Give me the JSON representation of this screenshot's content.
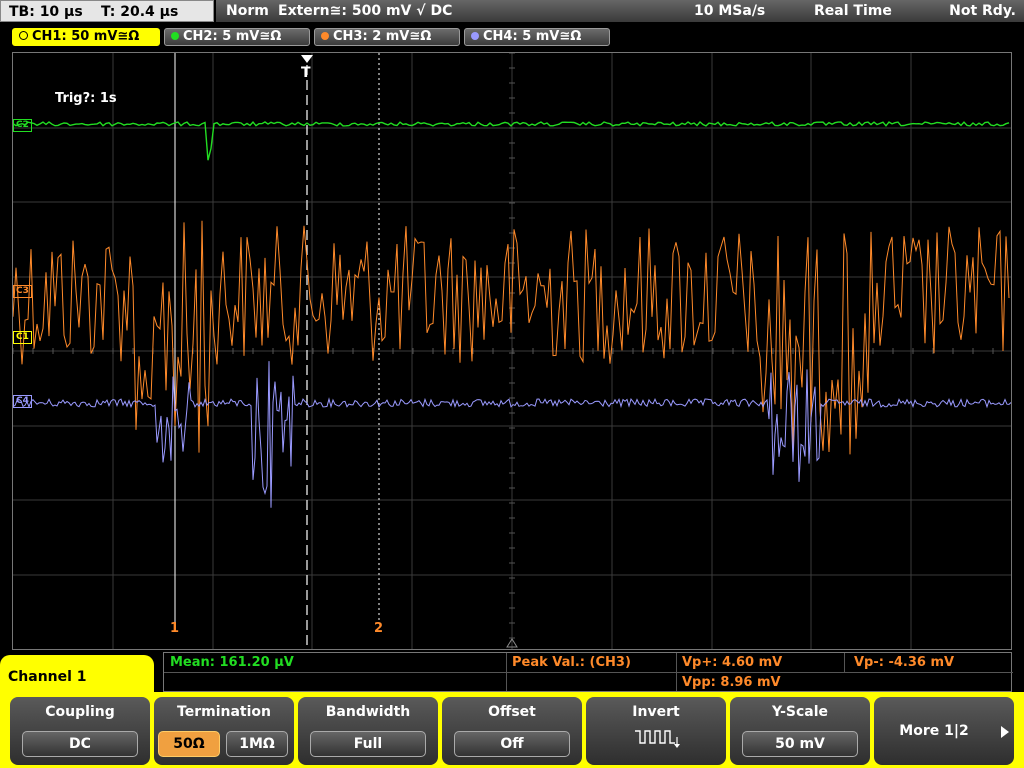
{
  "status_bar": {
    "timebase": "TB: 10 µs",
    "trigger_time": "T: 20.4 µs",
    "mode": "Norm",
    "trigger_source": "Extern≅: 500 mV √ DC",
    "sample_rate": "10 MSa/s",
    "acq_mode": "Real Time",
    "state": "Not Rdy."
  },
  "channel_tabs": [
    {
      "label": "CH1: 50 mV≅Ω",
      "color": "#ffff00",
      "active": true
    },
    {
      "label": "CH2: 5 mV≅Ω",
      "color": "#22dd22",
      "active": false
    },
    {
      "label": "CH3: 2 mV≅Ω",
      "color": "#ff8a2a",
      "active": false
    },
    {
      "label": "CH4: 5 mV≅Ω",
      "color": "#9a9aff",
      "active": false
    }
  ],
  "screen": {
    "trigger_status": "Trig?: 1s",
    "trigger_marker": "T",
    "cursor1_label": "1",
    "cursor2_label": "2",
    "markers": {
      "ch1": "C1",
      "ch2": "C2",
      "ch3": "C3",
      "ch4": "C4"
    },
    "colors": {
      "ch1": "#ffff00",
      "ch2": "#22dd22",
      "ch3": "#ff8a2a",
      "ch4": "#9a9aff",
      "grid": "#3a3a3a"
    }
  },
  "measurements": {
    "mean": "Mean: 161.20 µV",
    "peak_label": "Peak Val.:  (CH3)",
    "vp_plus": "Vp+: 4.60 mV",
    "vp_minus": "Vp-: -4.36 mV",
    "vpp": "Vpp: 8.96 mV"
  },
  "menu": {
    "title": "Channel 1",
    "softkeys": {
      "coupling": {
        "title": "Coupling",
        "value": "DC"
      },
      "termination": {
        "title": "Termination",
        "option_a": "50Ω",
        "option_b": "1MΩ"
      },
      "bandwidth": {
        "title": "Bandwidth",
        "value": "Full"
      },
      "offset": {
        "title": "Offset",
        "value": "Off"
      },
      "invert": {
        "title": "Invert",
        "icon": "invert-pulse-icon"
      },
      "yscale": {
        "title": "Y-Scale",
        "value": "50 mV"
      },
      "more": {
        "title": "More 1|2"
      }
    }
  }
}
